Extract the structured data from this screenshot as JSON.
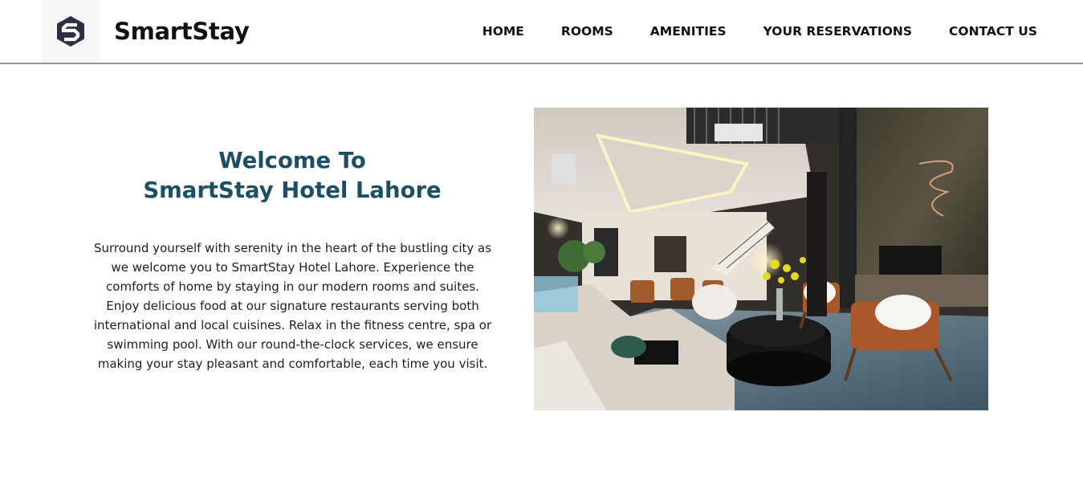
{
  "brand": {
    "name": "SmartStay",
    "logo_icon": "smartstay-s-logo-icon"
  },
  "nav": {
    "items": [
      {
        "label": "HOME"
      },
      {
        "label": "ROOMS"
      },
      {
        "label": "AMENITIES"
      },
      {
        "label": "YOUR RESERVATIONS"
      },
      {
        "label": "CONTACT US"
      }
    ]
  },
  "welcome": {
    "title_line1": "Welcome To",
    "title_line2": "SmartStay Hotel Lahore",
    "description": "Surround yourself with serenity in the heart of the bustling city as we welcome you to SmartStay Hotel Lahore. Experience the comforts of home by staying in our modern rooms and suites. Enjoy delicious food at our signature restaurants serving both international and local cuisines. Relax in the fitness centre, spa or swimming pool. With our round-the-clock services, we ensure making your stay pleasant and comfortable, each time you visit."
  },
  "colors": {
    "title": "#1d4f64",
    "header_border": "#8a9aa3",
    "text": "#1e1e1e"
  }
}
